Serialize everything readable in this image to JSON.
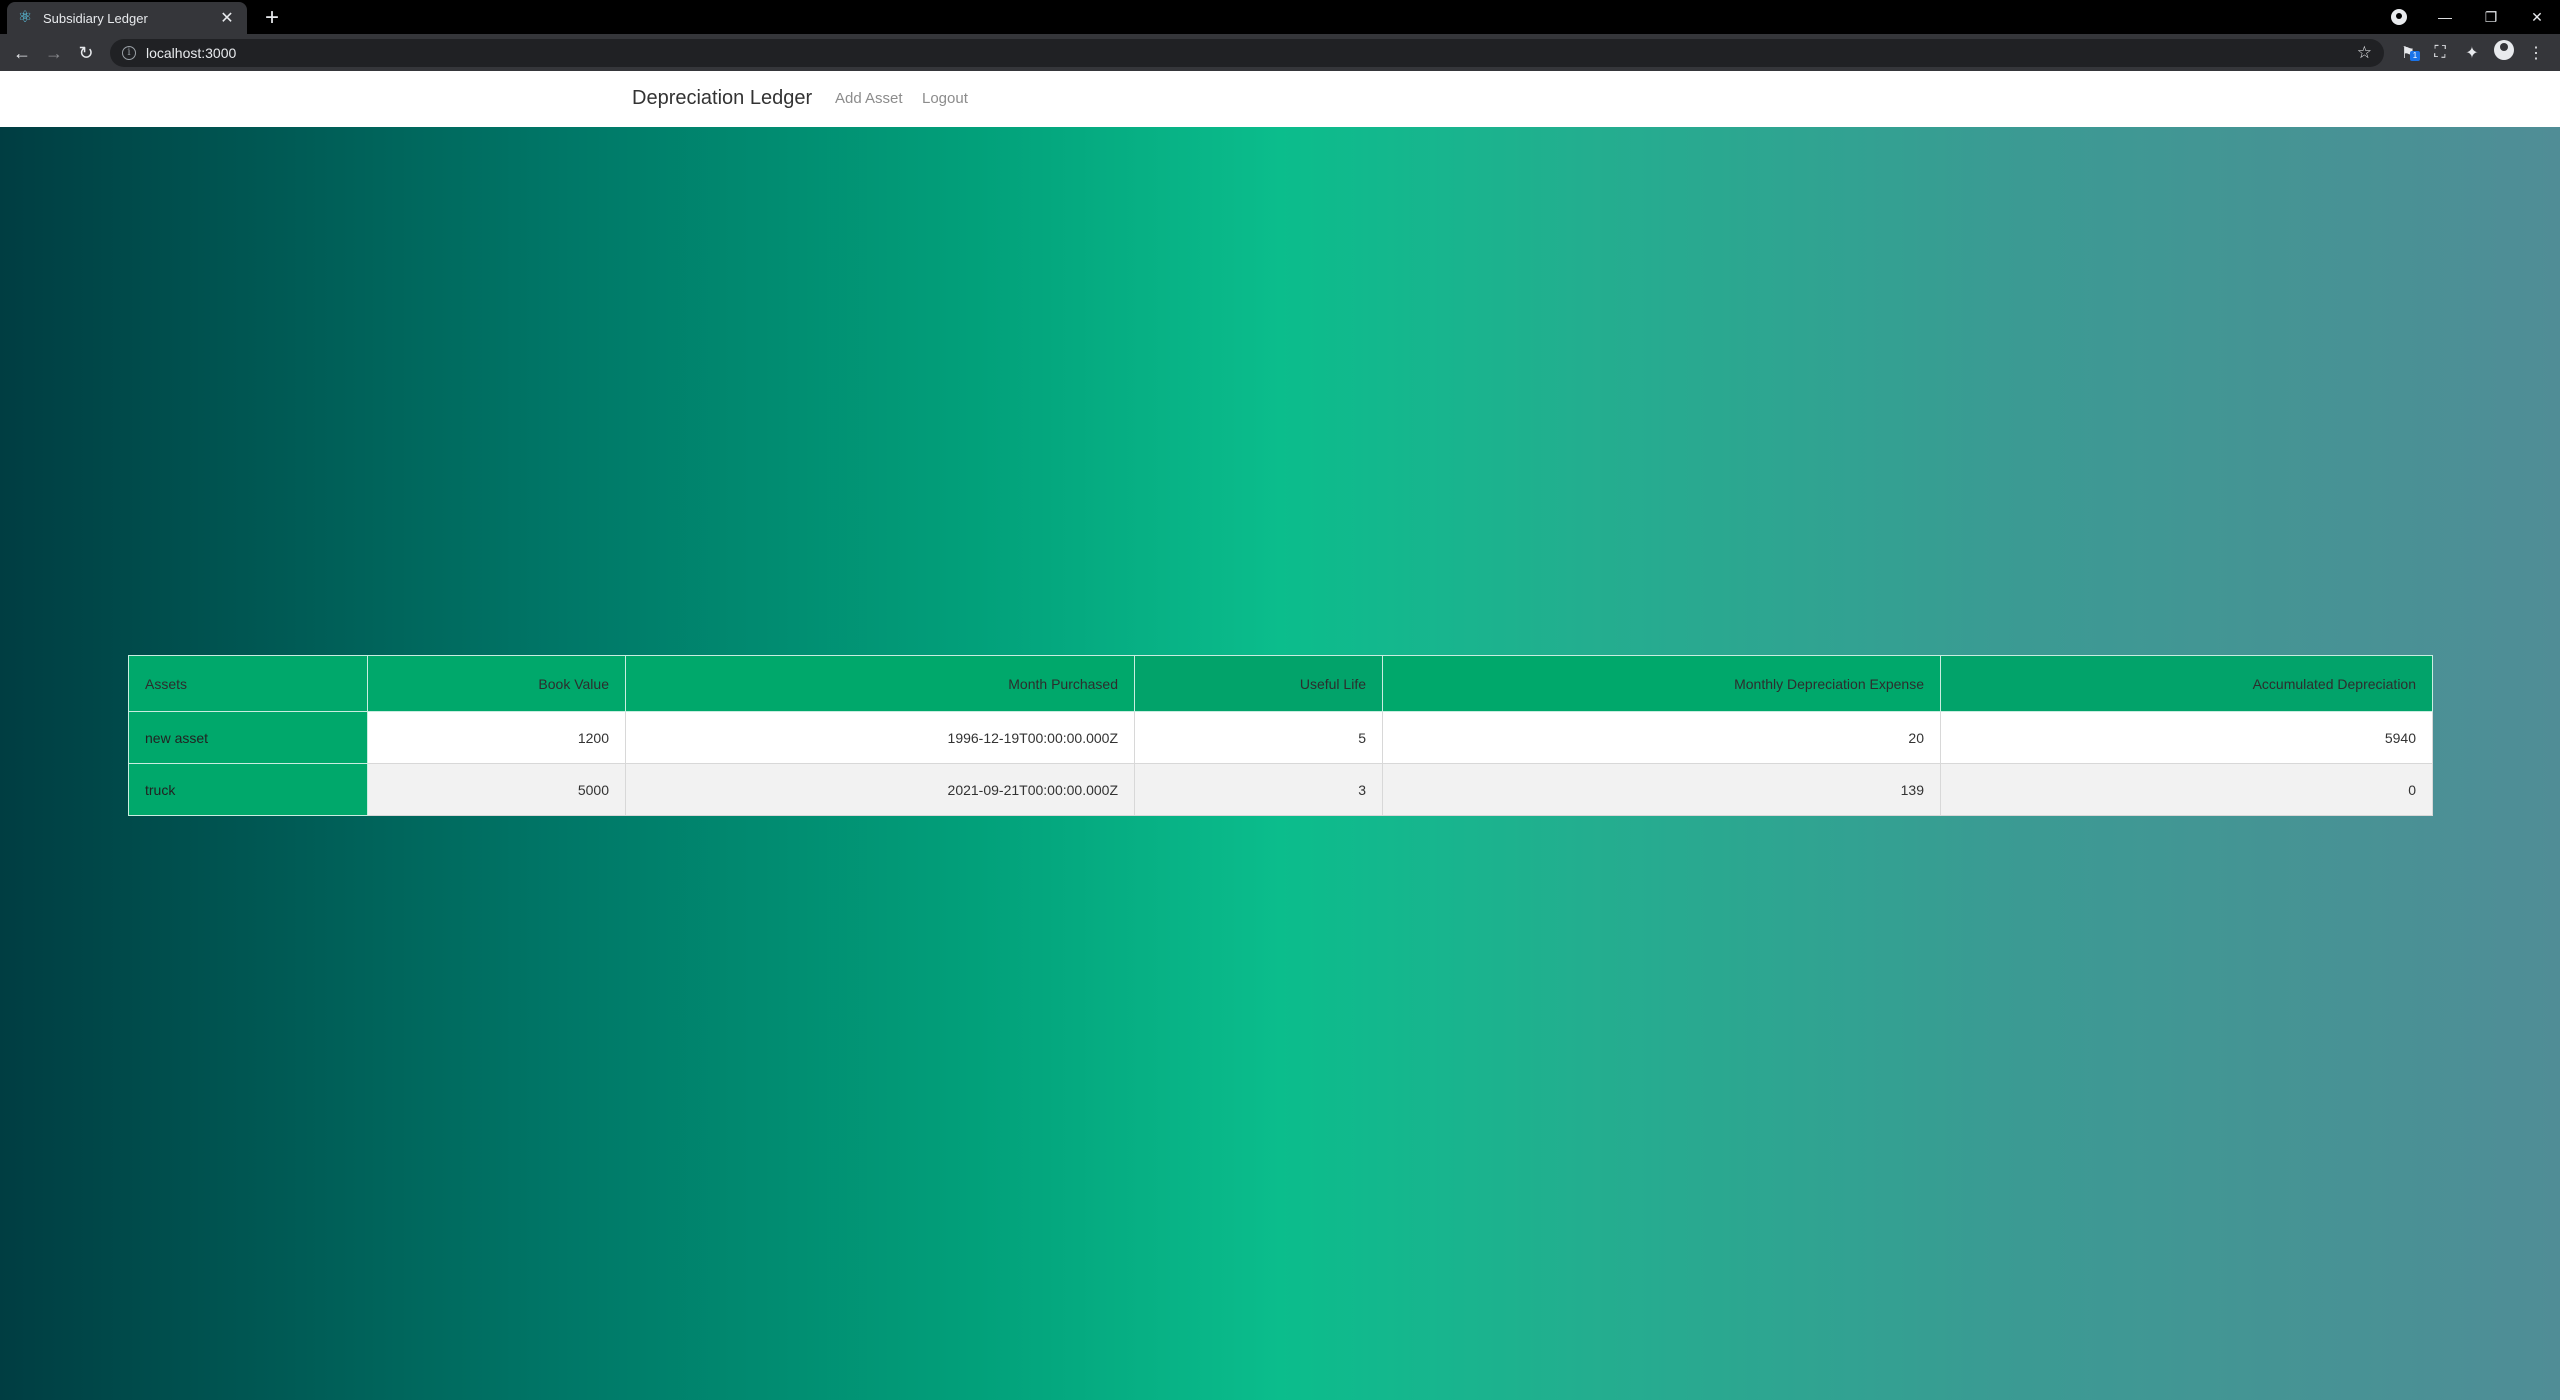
{
  "browser": {
    "tab_title": "Subsidiary Ledger",
    "tab_icon": "react-icon",
    "url": "localhost:3000"
  },
  "navbar": {
    "brand": "Depreciation Ledger",
    "links": [
      "Add Asset",
      "Logout"
    ]
  },
  "colors": {
    "table_accent": "#00a86b",
    "gradient_left": "#003d42",
    "gradient_mid": "#0bbd8c",
    "gradient_right": "#508d96"
  },
  "table": {
    "headers": [
      "Assets",
      "Book Value",
      "Month Purchased",
      "Useful Life",
      "Monthly Depreciation Expense",
      "Accumulated Depreciation"
    ],
    "rows": [
      [
        "new asset",
        "1200",
        "1996-12-19T00:00:00.000Z",
        "5",
        "20",
        "5940"
      ],
      [
        "truck",
        "5000",
        "2021-09-21T00:00:00.000Z",
        "3",
        "139",
        "0"
      ]
    ]
  }
}
